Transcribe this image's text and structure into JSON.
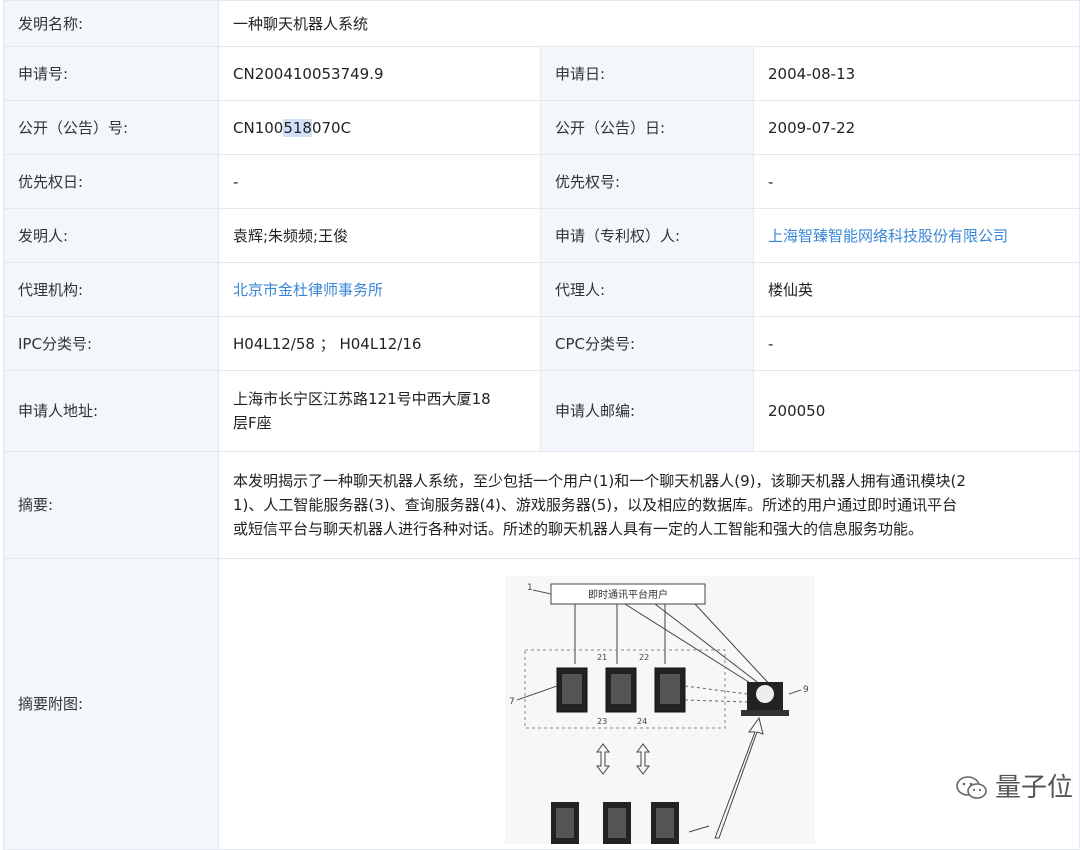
{
  "rows": {
    "title": {
      "label": "发明名称:",
      "value": "一种聊天机器人系统"
    },
    "app_no": {
      "label": "申请号:",
      "value": "CN200410053749.9",
      "label2": "申请日:",
      "value2": "2004-08-13"
    },
    "pub_no": {
      "label": "公开（公告）号:",
      "value_pre": "CN100",
      "value_hl": "518",
      "value_post": "070C",
      "label2": "公开（公告）日:",
      "value2": "2009-07-22"
    },
    "priority": {
      "label": "优先权日:",
      "value": "-",
      "label2": "优先权号:",
      "value2": "-"
    },
    "inventor": {
      "label": "发明人:",
      "value": "袁辉;朱频频;王俊",
      "label2": "申请（专利权）人:",
      "value2": "上海智臻智能网络科技股份有限公司"
    },
    "agency": {
      "label": "代理机构:",
      "value": "北京市金杜律师事务所",
      "label2": "代理人:",
      "value2": "楼仙英"
    },
    "ipc": {
      "label": "IPC分类号:",
      "value": "H04L12/58 ； H04L12/16",
      "label2": "CPC分类号:",
      "value2": "-"
    },
    "address": {
      "label": "申请人地址:",
      "value_line1": "上海市长宁区江苏路121号中西大厦18",
      "value_line2": "层F座",
      "label2": "申请人邮编:",
      "value2": "200050"
    },
    "abstract": {
      "label": "摘要:",
      "value_line1": "本发明揭示了一种聊天机器人系统，至少包括一个用户(1)和一个聊天机器人(9)，该聊天机器人拥有通讯模块(2",
      "value_line2": "1)、人工智能服务器(3)、查询服务器(4)、游戏服务器(5)，以及相应的数据库。所述的用户通过即时通讯平台",
      "value_line3": "或短信平台与聊天机器人进行各种对话。所述的聊天机器人具有一定的人工智能和强大的信息服务功能。"
    },
    "figure": {
      "label": "摘要附图:"
    }
  },
  "figure": {
    "top_box_text": "即时通讯平台用户",
    "refs": {
      "r1": "1",
      "r7": "7",
      "r9": "9",
      "r21": "21",
      "r22": "22",
      "r23": "23",
      "r24": "24"
    }
  },
  "watermark": {
    "text": "量子位",
    "icon": "wechat-icon"
  }
}
